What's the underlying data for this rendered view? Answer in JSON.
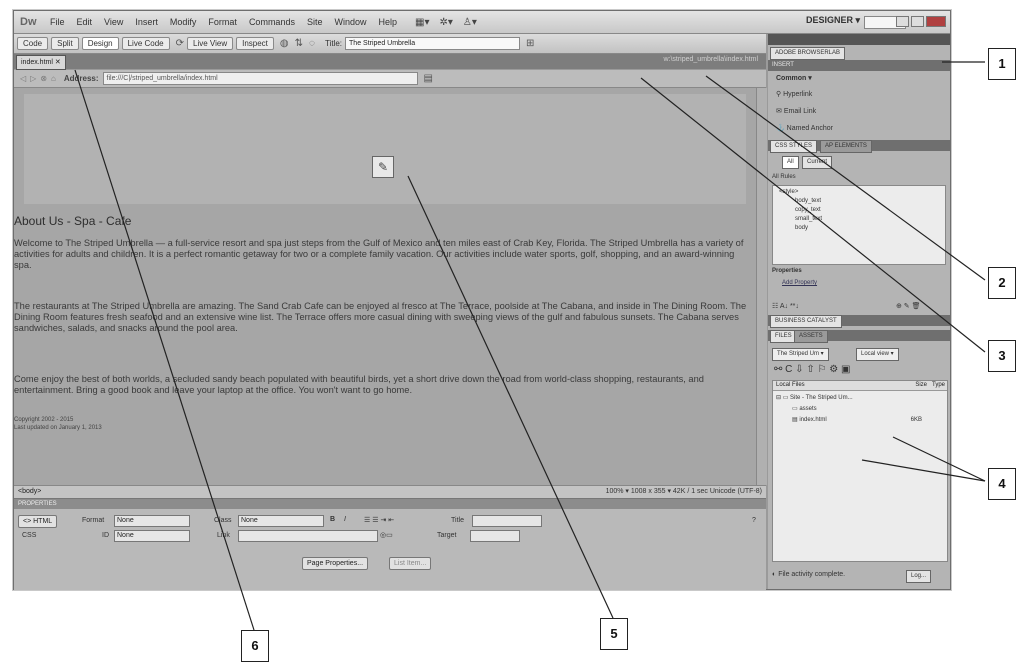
{
  "menubar": {
    "logo": "Dw",
    "items": [
      "File",
      "Edit",
      "View",
      "Insert",
      "Modify",
      "Format",
      "Commands",
      "Site",
      "Window",
      "Help"
    ],
    "workspace": "DESIGNER ▾"
  },
  "doc_toolbar": {
    "buttons": [
      "Code",
      "Split",
      "Design",
      "Live Code",
      "Live View",
      "Inspect"
    ],
    "title_label": "Title:",
    "title_value": "The Striped Umbrella"
  },
  "tab": {
    "filename": "index.html",
    "path": "w:\\striped_umbrella\\index.html"
  },
  "address": {
    "label": "Address:",
    "value": "file:///C|/striped_umbrella/index.html"
  },
  "document": {
    "heading": "About Us - Spa - Cafe",
    "paragraphs": [
      "Welcome to The Striped Umbrella — a full-service resort and spa just steps from the Gulf of Mexico and ten miles east of Crab Key, Florida. The Striped Umbrella has a variety of activities for adults and children. It is a perfect romantic getaway for two or a complete family vacation. Our activities include water sports, golf, shopping, and an award-winning spa.",
      "The restaurants at The Striped Umbrella are amazing. The Sand Crab Cafe can be enjoyed al fresco at The Terrace, poolside at The Cabana, and inside in The Dining Room. The Dining Room features fresh seafood and an extensive wine list. The Terrace offers more casual dining with sweeping views of the gulf and fabulous sunsets. The Cabana serves sandwiches, salads, and snacks around the pool area.",
      "Come enjoy the best of both worlds, a secluded sandy beach populated with beautiful birds, yet a short drive down the road from world-class shopping, restaurants, and entertainment. Bring a good book and leave your laptop at the office. You won't want to go home."
    ],
    "copyright": "Copyright 2002 - 2015",
    "updated": "Last updated on January 1, 2013"
  },
  "statusbar": {
    "tag": "<body>",
    "zoom": "100% ▾  1008 x 355 ▾  42K / 1 sec  Unicode (UTF-8)"
  },
  "properties": {
    "header": "PROPERTIES",
    "html_label": "<> HTML",
    "css_label": "CSS",
    "format_label": "Format",
    "format_value": "None",
    "id_label": "ID",
    "id_value": "None",
    "class_label": "Class",
    "class_value": "None",
    "link_label": "Link",
    "title_label": "Title",
    "target_label": "Target",
    "page_props": "Page Properties...",
    "list_item": "List Item..."
  },
  "panels": {
    "browserlab": "ADOBE BROWSERLAB",
    "insert": "INSERT",
    "insert_category": "Common ▾",
    "insert_items": [
      "Hyperlink",
      "Email Link",
      "Named Anchor"
    ],
    "css_tabs": [
      "CSS STYLES",
      "AP ELEMENTS"
    ],
    "css_modes": [
      "All",
      "Current"
    ],
    "all_rules": "All Rules",
    "rules": [
      "<style>",
      "body_text",
      "copy_text",
      "small_text",
      "body"
    ],
    "properties_label": "Properties",
    "add_property": "Add Property",
    "business_catalyst": "BUSINESS CATALYST",
    "files_tabs": [
      "FILES",
      "ASSETS"
    ],
    "site_select": "The Striped Um ▾",
    "view_select": "Local view ▾",
    "local_files": "Local Files",
    "size_col": "Size",
    "type_col": "Type",
    "site_root": "Site - The Striped Um...",
    "assets_folder": "assets",
    "index_file": "index.html",
    "index_size": "6KB",
    "log_status": "File activity complete.",
    "log_btn": "Log..."
  },
  "callouts": [
    "1",
    "2",
    "3",
    "4",
    "5",
    "6"
  ]
}
